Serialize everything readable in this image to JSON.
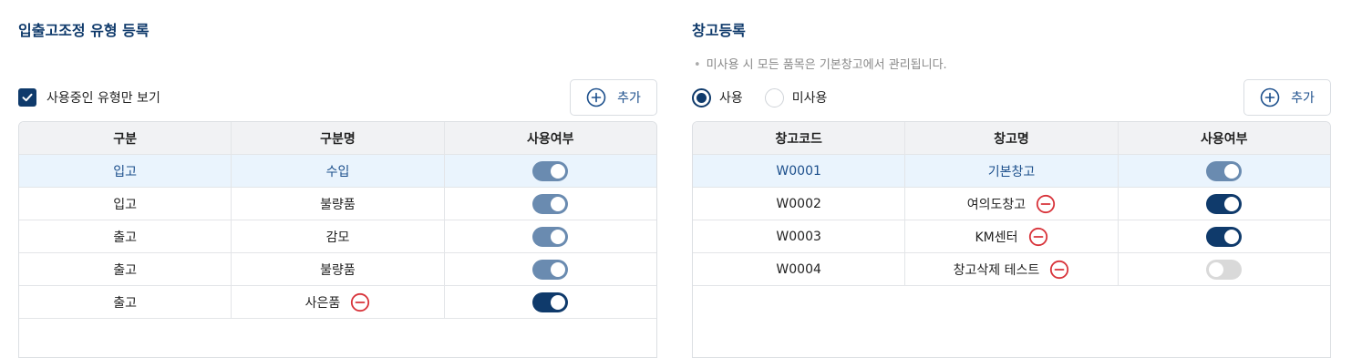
{
  "left_panel": {
    "title": "입출고조정 유형 등록",
    "filter_checkbox_label": "사용중인 유형만 보기",
    "add_label": "추가",
    "headers": [
      "구분",
      "구분명",
      "사용여부"
    ],
    "rows": [
      {
        "type": "입고",
        "name": "수입",
        "enabled": true,
        "deletable": false,
        "selected": true
      },
      {
        "type": "입고",
        "name": "불량품",
        "enabled": true,
        "deletable": false,
        "selected": false
      },
      {
        "type": "출고",
        "name": "감모",
        "enabled": true,
        "deletable": false,
        "selected": false
      },
      {
        "type": "출고",
        "name": "불량품",
        "enabled": true,
        "deletable": false,
        "selected": false
      },
      {
        "type": "출고",
        "name": "사은품",
        "enabled": true,
        "deletable": true,
        "selected": false
      }
    ]
  },
  "right_panel": {
    "title": "창고등록",
    "note": "미사용 시 모든 품목은 기본창고에서 관리됩니다.",
    "radio_use": "사용",
    "radio_unused": "미사용",
    "add_label": "추가",
    "headers": [
      "창고코드",
      "창고명",
      "사용여부"
    ],
    "rows": [
      {
        "code": "W0001",
        "name": "기본창고",
        "enabled": true,
        "deletable": false,
        "selected": true
      },
      {
        "code": "W0002",
        "name": "여의도창고",
        "enabled": true,
        "deletable": true,
        "selected": false
      },
      {
        "code": "W0003",
        "name": "KM센터",
        "enabled": true,
        "deletable": true,
        "selected": false
      },
      {
        "code": "W0004",
        "name": "창고삭제 테스트",
        "enabled": false,
        "deletable": true,
        "selected": false
      }
    ]
  },
  "colors": {
    "accent": "#0f3a6b",
    "toggle_muted": "#6a8bb0",
    "toggle_off": "#d9d9d9",
    "selected_row": "#eaf4fd",
    "delete_red": "#d8333a"
  }
}
